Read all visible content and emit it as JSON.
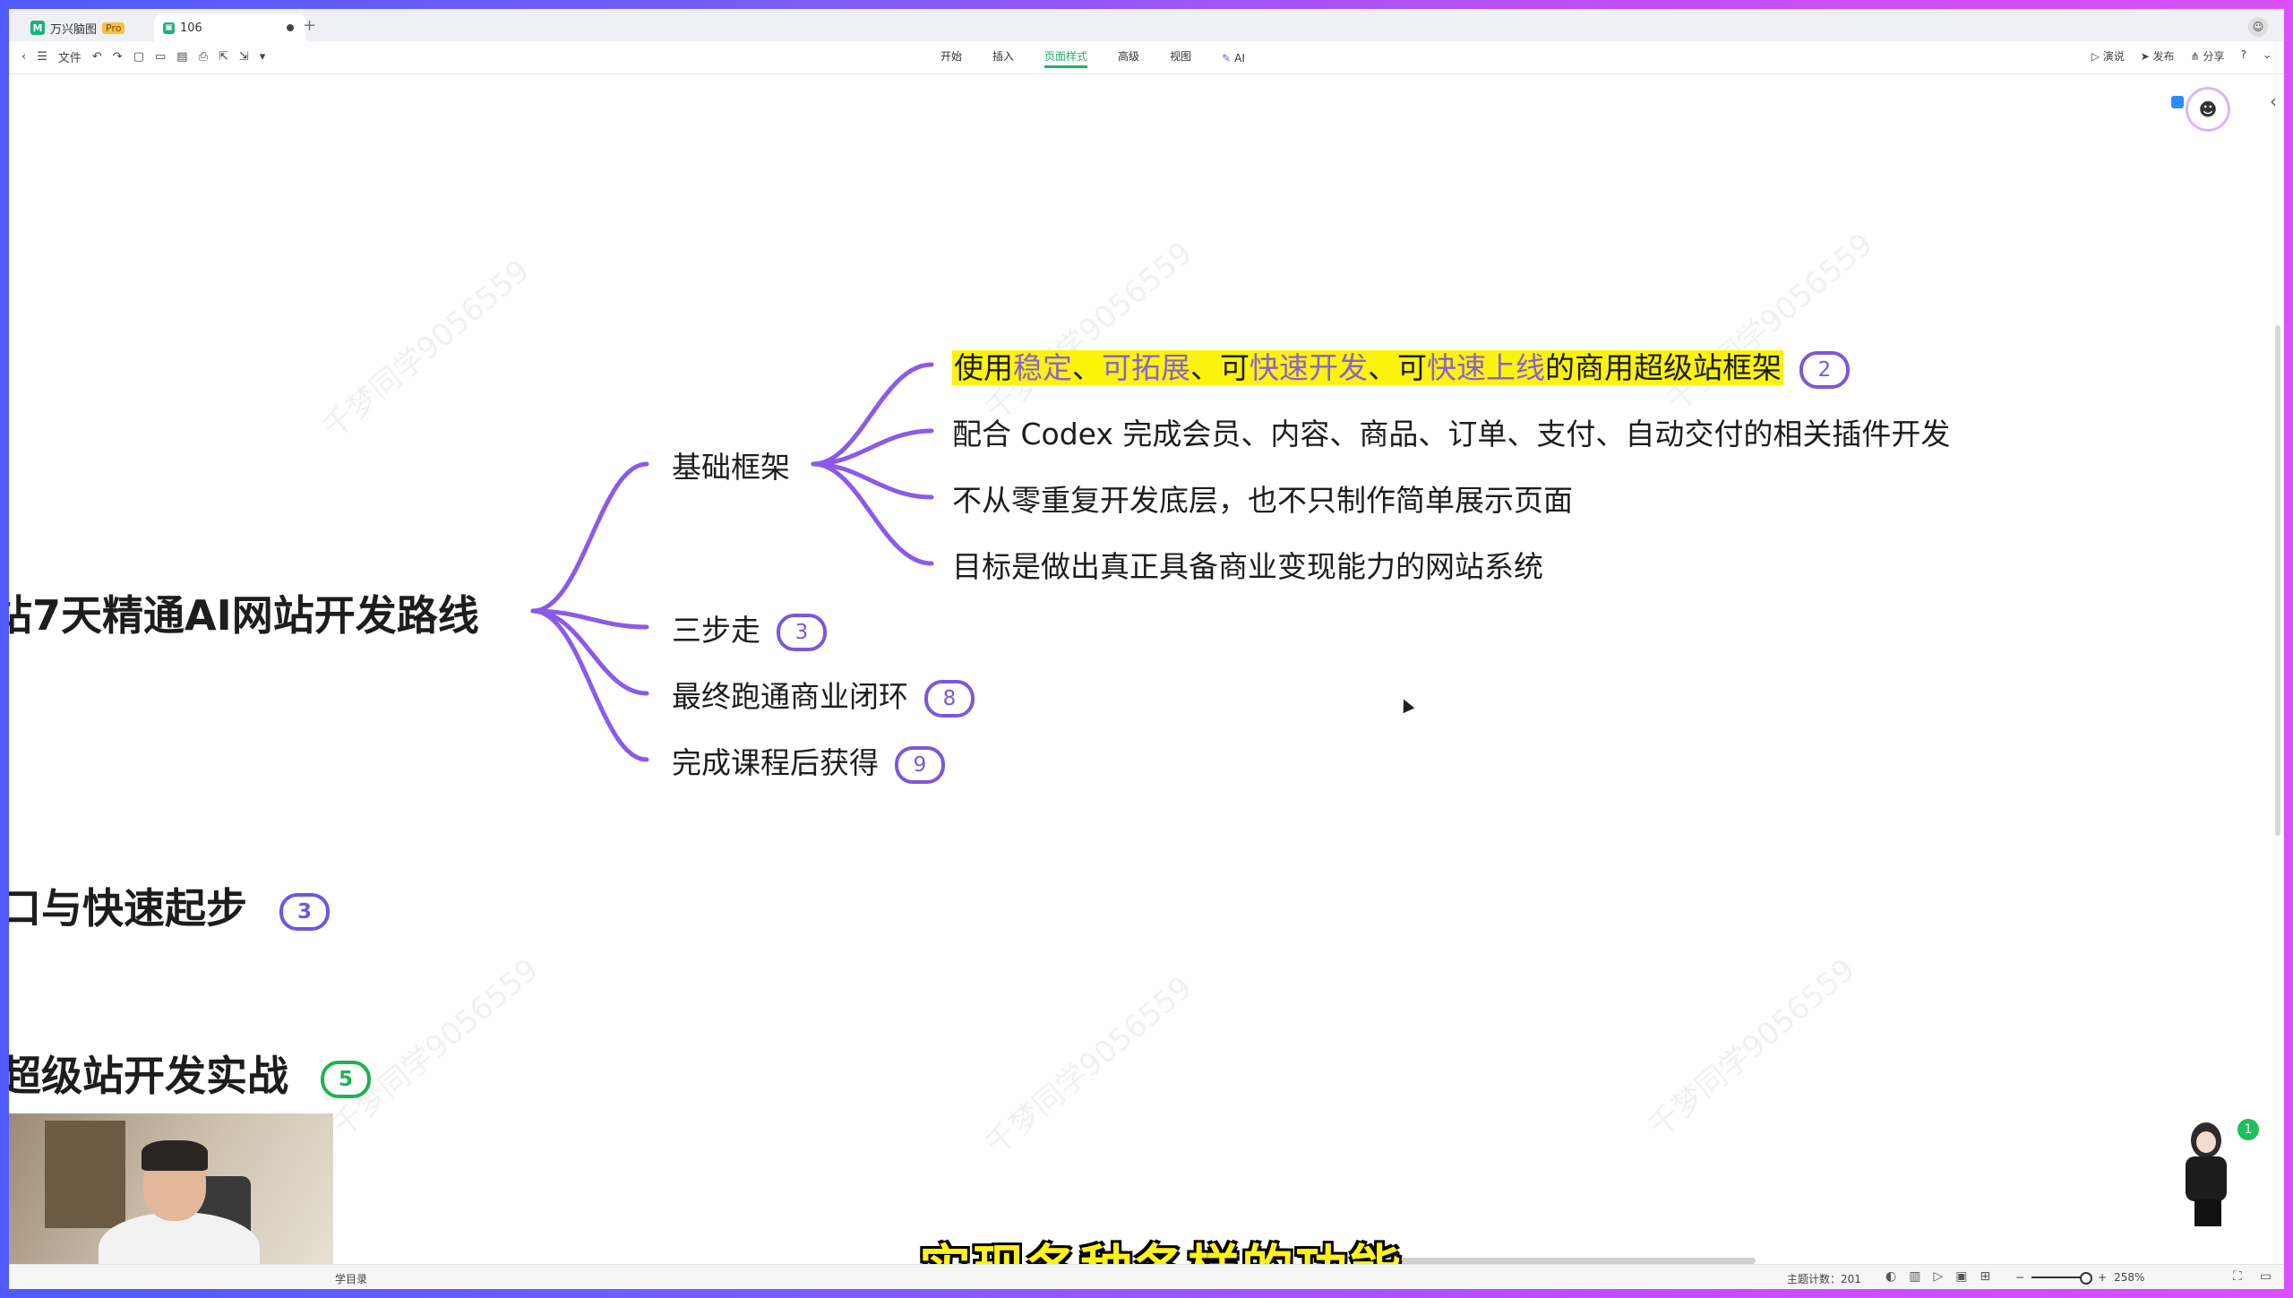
{
  "tabs": [
    {
      "label": "万兴脑图",
      "badge": "Pro"
    },
    {
      "label": "106"
    }
  ],
  "toolbar": {
    "file_label": "文件",
    "menus": [
      "开始",
      "插入",
      "页面样式",
      "高级",
      "视图"
    ],
    "ai_label": "AI",
    "right": [
      "演说",
      "发布",
      "分享"
    ]
  },
  "mindmap": {
    "root_1": "站7天精通AI网站开发路线",
    "branch_1": "基础框架",
    "leaf_1": {
      "p1": "使用",
      "p2": "稳定",
      "p3": "、",
      "p4": "可拓展",
      "p5": "、可",
      "p6": "快速开发",
      "p7": "、可",
      "p8": "快速上线",
      "p9": "的商用超级站框架",
      "badge": "2"
    },
    "leaf_2": "配合 Codex 完成会员、内容、商品、订单、支付、自动交付的相关插件开发",
    "leaf_3": "不从零重复开发底层，也不只制作简单展示页面",
    "leaf_4": "目标是做出真正具备商业变现能力的网站系统",
    "branch_2": {
      "label": "三步走",
      "badge": "3"
    },
    "branch_3": {
      "label": "最终跑通商业闭环",
      "badge": "8"
    },
    "branch_4": {
      "label": "完成课程后获得",
      "badge": "9"
    },
    "root_2": {
      "label": "口与快速起步",
      "badge": "3"
    },
    "root_3": {
      "label": "超级站开发实战",
      "badge": "5"
    }
  },
  "watermark": "千梦同学9056559",
  "notification_count": "1",
  "subtitle": "实现各种各样的功能",
  "status": {
    "left": "学目录",
    "topic_count_label": "主题计数：",
    "topic_count": "201",
    "zoom": "258%"
  },
  "colors": {
    "branch_line": "#8a5bea",
    "highlight": "#fbf30a",
    "badge_green": "#1fb253",
    "accent": "#20b26a"
  }
}
